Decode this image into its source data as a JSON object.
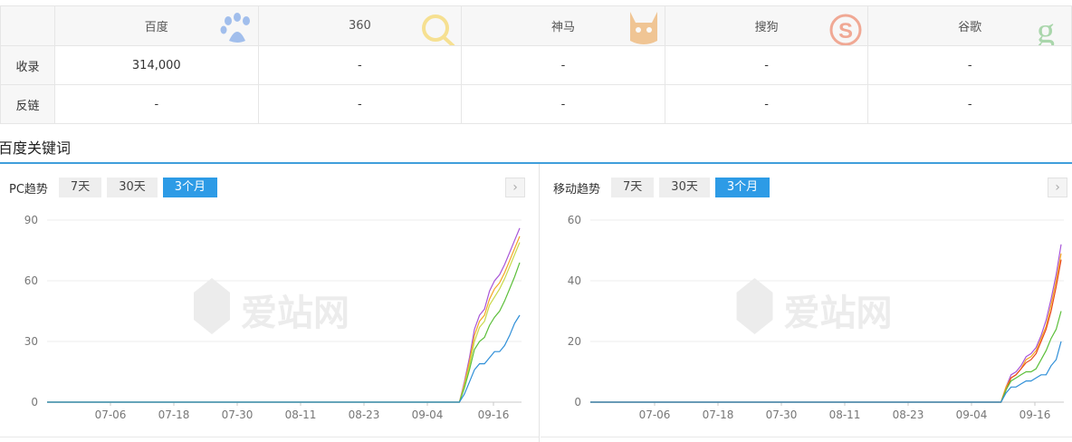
{
  "table": {
    "engines": [
      {
        "name": "百度",
        "logo": "baidu-paw-icon",
        "color": "#3a7be0"
      },
      {
        "name": "360",
        "logo": "360-search-icon",
        "color": "#f5c518"
      },
      {
        "name": "神马",
        "logo": "shenma-icon",
        "color": "#e88a1e"
      },
      {
        "name": "搜狗",
        "logo": "sogou-icon",
        "color": "#e8491d"
      },
      {
        "name": "谷歌",
        "logo": "google-g-icon",
        "color": "#4caf50"
      }
    ],
    "rows": [
      {
        "label": "收录",
        "values": [
          "314,000",
          "-",
          "-",
          "-",
          "-"
        ]
      },
      {
        "label": "反链",
        "values": [
          "-",
          "-",
          "-",
          "-",
          "-"
        ]
      }
    ]
  },
  "section": {
    "title": "百度关键词"
  },
  "watermark": "爱站网",
  "panels": {
    "pc": {
      "label": "PC趋势",
      "tabs": [
        "7天",
        "30天",
        "3个月"
      ],
      "active_tab": "3个月",
      "next": "›"
    },
    "mobile": {
      "label": "移动趋势",
      "tabs": [
        "7天",
        "30天",
        "3个月"
      ],
      "active_tab": "3个月",
      "next": "›"
    }
  },
  "chart_data": [
    {
      "type": "line",
      "title": "PC趋势",
      "ylim": [
        0,
        90
      ],
      "yticks": [
        0,
        30,
        60,
        90
      ],
      "xticks": [
        "07-06",
        "07-18",
        "07-30",
        "08-11",
        "08-23",
        "09-04",
        "09-16"
      ],
      "grid": true,
      "series": [
        {
          "color": "#a855d8",
          "values": [
            0,
            0,
            0,
            0,
            0,
            0,
            0,
            0,
            0,
            0,
            0,
            0,
            0,
            0,
            0,
            0,
            0,
            0,
            0,
            0,
            0,
            0,
            0,
            0,
            0,
            0,
            0,
            0,
            0,
            0,
            0,
            0,
            0,
            0,
            0,
            0,
            0,
            0,
            0,
            0,
            0,
            0,
            0,
            0,
            0,
            0,
            0,
            0,
            0,
            0,
            0,
            0,
            0,
            0,
            0,
            0,
            0,
            0,
            0,
            0,
            0,
            0,
            0,
            0,
            0,
            0,
            0,
            0,
            0,
            0,
            0,
            0,
            0,
            0,
            0,
            0,
            0,
            0,
            0,
            0,
            0,
            0,
            0,
            10,
            22,
            36,
            43,
            46,
            55,
            60,
            63,
            68,
            74,
            80,
            86
          ]
        },
        {
          "color": "#f5a623",
          "values": [
            0,
            0,
            0,
            0,
            0,
            0,
            0,
            0,
            0,
            0,
            0,
            0,
            0,
            0,
            0,
            0,
            0,
            0,
            0,
            0,
            0,
            0,
            0,
            0,
            0,
            0,
            0,
            0,
            0,
            0,
            0,
            0,
            0,
            0,
            0,
            0,
            0,
            0,
            0,
            0,
            0,
            0,
            0,
            0,
            0,
            0,
            0,
            0,
            0,
            0,
            0,
            0,
            0,
            0,
            0,
            0,
            0,
            0,
            0,
            0,
            0,
            0,
            0,
            0,
            0,
            0,
            0,
            0,
            0,
            0,
            0,
            0,
            0,
            0,
            0,
            0,
            0,
            0,
            0,
            0,
            0,
            0,
            0,
            9,
            20,
            33,
            40,
            43,
            51,
            56,
            59,
            64,
            70,
            76,
            82
          ]
        },
        {
          "color": "#c8d94a",
          "values": [
            0,
            0,
            0,
            0,
            0,
            0,
            0,
            0,
            0,
            0,
            0,
            0,
            0,
            0,
            0,
            0,
            0,
            0,
            0,
            0,
            0,
            0,
            0,
            0,
            0,
            0,
            0,
            0,
            0,
            0,
            0,
            0,
            0,
            0,
            0,
            0,
            0,
            0,
            0,
            0,
            0,
            0,
            0,
            0,
            0,
            0,
            0,
            0,
            0,
            0,
            0,
            0,
            0,
            0,
            0,
            0,
            0,
            0,
            0,
            0,
            0,
            0,
            0,
            0,
            0,
            0,
            0,
            0,
            0,
            0,
            0,
            0,
            0,
            0,
            0,
            0,
            0,
            0,
            0,
            0,
            0,
            0,
            0,
            8,
            18,
            30,
            37,
            40,
            48,
            52,
            56,
            61,
            67,
            73,
            79
          ]
        },
        {
          "color": "#5cbf3a",
          "values": [
            0,
            0,
            0,
            0,
            0,
            0,
            0,
            0,
            0,
            0,
            0,
            0,
            0,
            0,
            0,
            0,
            0,
            0,
            0,
            0,
            0,
            0,
            0,
            0,
            0,
            0,
            0,
            0,
            0,
            0,
            0,
            0,
            0,
            0,
            0,
            0,
            0,
            0,
            0,
            0,
            0,
            0,
            0,
            0,
            0,
            0,
            0,
            0,
            0,
            0,
            0,
            0,
            0,
            0,
            0,
            0,
            0,
            0,
            0,
            0,
            0,
            0,
            0,
            0,
            0,
            0,
            0,
            0,
            0,
            0,
            0,
            0,
            0,
            0,
            0,
            0,
            0,
            0,
            0,
            0,
            0,
            0,
            0,
            7,
            16,
            26,
            30,
            32,
            38,
            42,
            45,
            50,
            56,
            62,
            69
          ]
        },
        {
          "color": "#2f8fd8",
          "values": [
            0,
            0,
            0,
            0,
            0,
            0,
            0,
            0,
            0,
            0,
            0,
            0,
            0,
            0,
            0,
            0,
            0,
            0,
            0,
            0,
            0,
            0,
            0,
            0,
            0,
            0,
            0,
            0,
            0,
            0,
            0,
            0,
            0,
            0,
            0,
            0,
            0,
            0,
            0,
            0,
            0,
            0,
            0,
            0,
            0,
            0,
            0,
            0,
            0,
            0,
            0,
            0,
            0,
            0,
            0,
            0,
            0,
            0,
            0,
            0,
            0,
            0,
            0,
            0,
            0,
            0,
            0,
            0,
            0,
            0,
            0,
            0,
            0,
            0,
            0,
            0,
            0,
            0,
            0,
            0,
            0,
            0,
            0,
            4,
            10,
            16,
            19,
            19,
            22,
            25,
            25,
            28,
            33,
            39,
            43
          ]
        }
      ]
    },
    {
      "type": "line",
      "title": "移动趋势",
      "ylim": [
        0,
        60
      ],
      "yticks": [
        0,
        20,
        40,
        60
      ],
      "xticks": [
        "07-06",
        "07-18",
        "07-30",
        "08-11",
        "08-23",
        "09-04",
        "09-16"
      ],
      "grid": true,
      "series": [
        {
          "color": "#a855d8",
          "values": [
            0,
            0,
            0,
            0,
            0,
            0,
            0,
            0,
            0,
            0,
            0,
            0,
            0,
            0,
            0,
            0,
            0,
            0,
            0,
            0,
            0,
            0,
            0,
            0,
            0,
            0,
            0,
            0,
            0,
            0,
            0,
            0,
            0,
            0,
            0,
            0,
            0,
            0,
            0,
            0,
            0,
            0,
            0,
            0,
            0,
            0,
            0,
            0,
            0,
            0,
            0,
            0,
            0,
            0,
            0,
            0,
            0,
            0,
            0,
            0,
            0,
            0,
            0,
            0,
            0,
            0,
            0,
            0,
            0,
            0,
            0,
            0,
            0,
            0,
            0,
            0,
            0,
            0,
            0,
            0,
            0,
            0,
            0,
            5,
            9,
            10,
            12,
            15,
            16,
            18,
            22,
            27,
            34,
            42,
            52
          ]
        },
        {
          "color": "#f5a623",
          "values": [
            0,
            0,
            0,
            0,
            0,
            0,
            0,
            0,
            0,
            0,
            0,
            0,
            0,
            0,
            0,
            0,
            0,
            0,
            0,
            0,
            0,
            0,
            0,
            0,
            0,
            0,
            0,
            0,
            0,
            0,
            0,
            0,
            0,
            0,
            0,
            0,
            0,
            0,
            0,
            0,
            0,
            0,
            0,
            0,
            0,
            0,
            0,
            0,
            0,
            0,
            0,
            0,
            0,
            0,
            0,
            0,
            0,
            0,
            0,
            0,
            0,
            0,
            0,
            0,
            0,
            0,
            0,
            0,
            0,
            0,
            0,
            0,
            0,
            0,
            0,
            0,
            0,
            0,
            0,
            0,
            0,
            0,
            0,
            5,
            8,
            9,
            11,
            14,
            15,
            17,
            21,
            25,
            32,
            40,
            49
          ]
        },
        {
          "color": "#e8491d",
          "values": [
            0,
            0,
            0,
            0,
            0,
            0,
            0,
            0,
            0,
            0,
            0,
            0,
            0,
            0,
            0,
            0,
            0,
            0,
            0,
            0,
            0,
            0,
            0,
            0,
            0,
            0,
            0,
            0,
            0,
            0,
            0,
            0,
            0,
            0,
            0,
            0,
            0,
            0,
            0,
            0,
            0,
            0,
            0,
            0,
            0,
            0,
            0,
            0,
            0,
            0,
            0,
            0,
            0,
            0,
            0,
            0,
            0,
            0,
            0,
            0,
            0,
            0,
            0,
            0,
            0,
            0,
            0,
            0,
            0,
            0,
            0,
            0,
            0,
            0,
            0,
            0,
            0,
            0,
            0,
            0,
            0,
            0,
            0,
            4,
            8,
            9,
            11,
            13,
            14,
            16,
            20,
            24,
            30,
            38,
            47
          ]
        },
        {
          "color": "#5cbf3a",
          "values": [
            0,
            0,
            0,
            0,
            0,
            0,
            0,
            0,
            0,
            0,
            0,
            0,
            0,
            0,
            0,
            0,
            0,
            0,
            0,
            0,
            0,
            0,
            0,
            0,
            0,
            0,
            0,
            0,
            0,
            0,
            0,
            0,
            0,
            0,
            0,
            0,
            0,
            0,
            0,
            0,
            0,
            0,
            0,
            0,
            0,
            0,
            0,
            0,
            0,
            0,
            0,
            0,
            0,
            0,
            0,
            0,
            0,
            0,
            0,
            0,
            0,
            0,
            0,
            0,
            0,
            0,
            0,
            0,
            0,
            0,
            0,
            0,
            0,
            0,
            0,
            0,
            0,
            0,
            0,
            0,
            0,
            0,
            0,
            4,
            7,
            8,
            9,
            10,
            10,
            11,
            14,
            17,
            21,
            24,
            30
          ]
        },
        {
          "color": "#2f8fd8",
          "values": [
            0,
            0,
            0,
            0,
            0,
            0,
            0,
            0,
            0,
            0,
            0,
            0,
            0,
            0,
            0,
            0,
            0,
            0,
            0,
            0,
            0,
            0,
            0,
            0,
            0,
            0,
            0,
            0,
            0,
            0,
            0,
            0,
            0,
            0,
            0,
            0,
            0,
            0,
            0,
            0,
            0,
            0,
            0,
            0,
            0,
            0,
            0,
            0,
            0,
            0,
            0,
            0,
            0,
            0,
            0,
            0,
            0,
            0,
            0,
            0,
            0,
            0,
            0,
            0,
            0,
            0,
            0,
            0,
            0,
            0,
            0,
            0,
            0,
            0,
            0,
            0,
            0,
            0,
            0,
            0,
            0,
            0,
            0,
            3,
            5,
            5,
            6,
            7,
            7,
            8,
            9,
            9,
            12,
            14,
            20
          ]
        }
      ]
    }
  ]
}
